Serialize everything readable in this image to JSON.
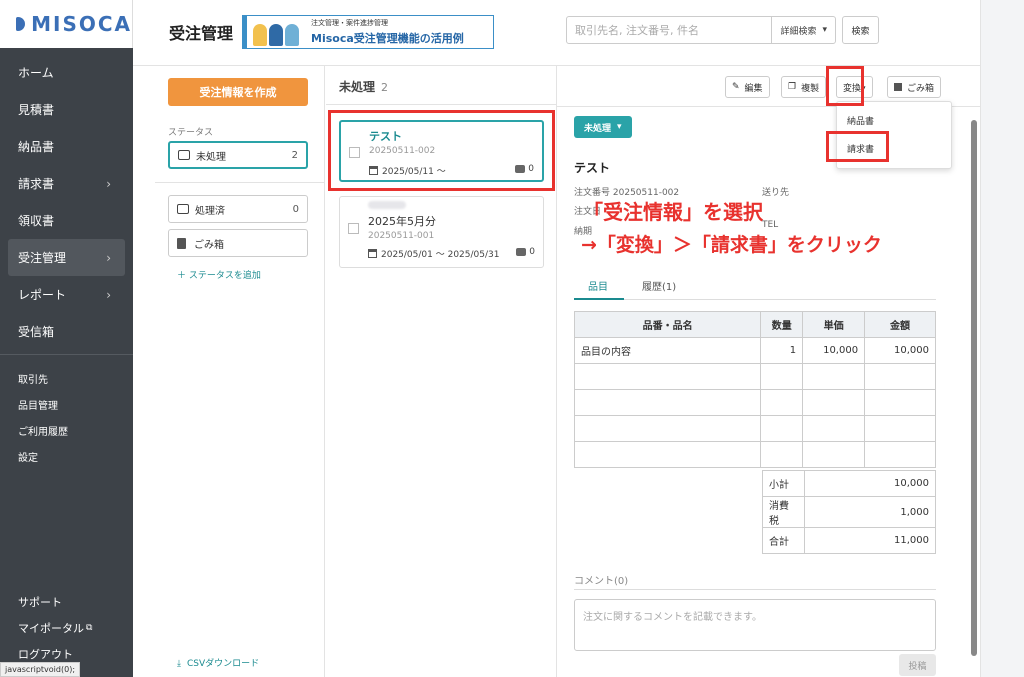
{
  "app": {
    "logo": "MISOCA"
  },
  "sidebar": {
    "main": [
      {
        "label": "ホーム",
        "chevron": false
      },
      {
        "label": "見積書",
        "chevron": false
      },
      {
        "label": "納品書",
        "chevron": false
      },
      {
        "label": "請求書",
        "chevron": true
      },
      {
        "label": "領収書",
        "chevron": false
      },
      {
        "label": "受注管理",
        "chevron": true,
        "active": true
      },
      {
        "label": "レポート",
        "chevron": true
      },
      {
        "label": "受信箱",
        "chevron": false
      }
    ],
    "sub": [
      "取引先",
      "品目管理",
      "ご利用履歴",
      "設定"
    ],
    "bottom": [
      "サポート",
      "マイポータル",
      "ログアウト"
    ],
    "status_link": "javascriptvoid(0);"
  },
  "header": {
    "title": "受注管理",
    "banner_small": "注文管理・案件進捗管理",
    "banner_big": "Misoca受注管理機能の活用例",
    "search_placeholder": "取引先名, 注文番号, 件名",
    "advanced_search": "詳細検索",
    "search_button": "検索"
  },
  "status_panel": {
    "create_button": "受注情報を作成",
    "label": "ステータス",
    "items": [
      {
        "name": "未処理",
        "count": "2"
      },
      {
        "name": "処理済",
        "count": "0"
      },
      {
        "name": "ごみ箱",
        "count": ""
      }
    ],
    "add_status": "＋ ステータスを追加",
    "csv_download": "CSVダウンロード"
  },
  "order_list": {
    "heading": "未処理",
    "count": "2",
    "orders": [
      {
        "title": "テスト",
        "number": "20250511-002",
        "dates": "2025/05/11 〜",
        "comments": "0"
      },
      {
        "title": "2025年5月分",
        "number": "20250511-001",
        "dates": "2025/05/01 〜 2025/05/31",
        "comments": "0"
      }
    ]
  },
  "detail": {
    "toolbar": {
      "edit": "編集",
      "copy": "複製",
      "convert": "変換▾",
      "trash": "ごみ箱"
    },
    "convert_menu": [
      "納品書",
      "請求書"
    ],
    "status": "未処理",
    "title": "テスト",
    "order_number_label": "注文番号",
    "order_number": "20250511-002",
    "order_date_label": "注文日",
    "due_label": "納期",
    "ship_to_label": "送り先",
    "tel_label": "TEL",
    "tabs": [
      "品目",
      "履歴(1)"
    ],
    "table_headers": [
      "品番・品名",
      "数量",
      "単価",
      "金額"
    ],
    "rows": [
      [
        "品目の内容",
        "1",
        "10,000",
        "10,000"
      ],
      [
        "",
        "",
        "",
        ""
      ],
      [
        "",
        "",
        "",
        ""
      ],
      [
        "",
        "",
        "",
        ""
      ],
      [
        "",
        "",
        "",
        ""
      ]
    ],
    "totals": [
      {
        "label": "小計",
        "value": "10,000"
      },
      {
        "label": "消費税",
        "value": "1,000"
      },
      {
        "label": "合計",
        "value": "11,000"
      }
    ],
    "comment_label": "コメント(0)",
    "comment_placeholder": "注文に関するコメントを記載できます。",
    "post_button": "投稿"
  },
  "annotations": {
    "line1": "「受注情報」を選択",
    "line2": "→「変換」＞「請求書」をクリック"
  },
  "colors": {
    "accent": "#2aa3a8",
    "orange": "#f0953e",
    "sidebar": "#3d4248",
    "highlight": "#e8322e"
  }
}
